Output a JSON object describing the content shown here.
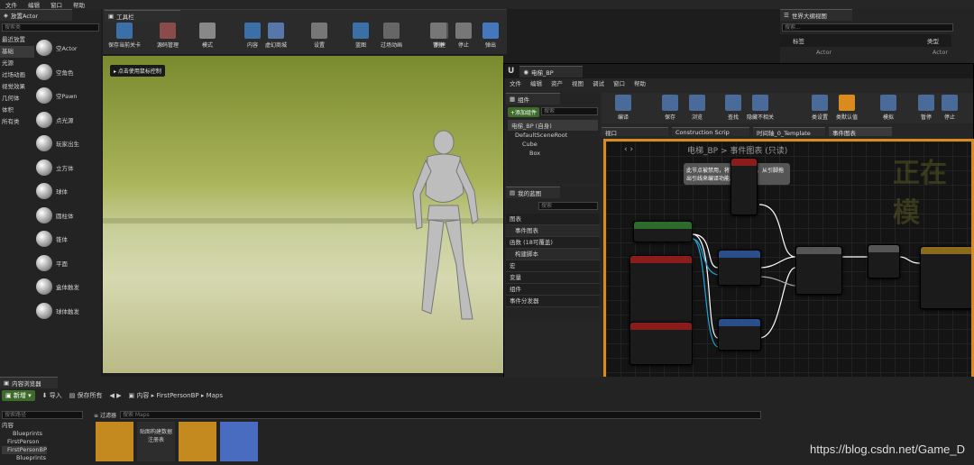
{
  "menu": [
    "文件",
    "编辑",
    "窗口",
    "帮助"
  ],
  "place": {
    "tab": "放置Actor",
    "search": "搜索类",
    "cats": [
      "最近放置",
      "基础",
      "光源",
      "过场动画",
      "视觉效果",
      "几何体",
      "体积",
      "所有类"
    ],
    "items": [
      "空Actor",
      "空角色",
      "空Pawn",
      "点光源",
      "玩家出生",
      "立方体",
      "球体",
      "圆柱体",
      "锥体",
      "平面",
      "盒体触发",
      "球体触发"
    ]
  },
  "toolbar": {
    "tab": "工具栏",
    "buttons": [
      "保存当前关卡",
      "源码管理",
      "模式",
      "内容",
      "虚幻商城",
      "设置",
      "蓝图",
      "过场动画",
      "构建",
      "暂停",
      "停止",
      "弹出"
    ]
  },
  "viewport": {
    "hint": "点击使用鼠标控制"
  },
  "world": {
    "tab": "世界大纲视图",
    "search": "搜索...",
    "col1": "标签",
    "col2": "类型",
    "row_name": "Actor",
    "row_type": "Actor"
  },
  "bp": {
    "tab": "电梯_BP",
    "menu": [
      "文件",
      "编辑",
      "资产",
      "视图",
      "调试",
      "窗口",
      "帮助"
    ],
    "comp_tab": "组件",
    "add_btn": "+添加组件",
    "comp_search": "搜索",
    "comp_self": "电梯_BP (自身)",
    "tree": [
      "DefaultSceneRoot",
      "Cube",
      "Box"
    ],
    "mybp": "我的蓝图",
    "mybp_search": "搜索",
    "sections": [
      "图表",
      "事件图表",
      "函数 (18可覆盖)",
      "构建脚本",
      "宏",
      "变量",
      "组件",
      "事件分发器"
    ],
    "tools": [
      "编译",
      "保存",
      "浏览",
      "查找",
      "隐藏不相关",
      "类设置",
      "类默认值",
      "模拟",
      "暂停",
      "停止"
    ],
    "tabs": [
      "视口",
      "Construction Scrip",
      "时间轴_0_Template",
      "事件图表"
    ],
    "breadcrumb": "电梯_BP > 事件图表 (只读)",
    "overlay": "正在模",
    "comment": "此节点被禁用，将不会被调用。从引脚拖出引线来编译功能。"
  },
  "content": {
    "tab": "内容浏览器",
    "new": "新增",
    "import": "导入",
    "saveall": "保存所有",
    "path": [
      "内容",
      "FirstPersonBP",
      "Maps"
    ],
    "filter": "过滤器",
    "search_maps": "搜索 Maps",
    "search_folder": "搜索路径",
    "tree": [
      "内容",
      "Blueprints",
      "FirstPerson",
      "FirstPersonBP",
      "Blueprints"
    ],
    "asset_label": "贴图构建数据注册表"
  },
  "watermark": "https://blog.csdn.net/Game_D"
}
